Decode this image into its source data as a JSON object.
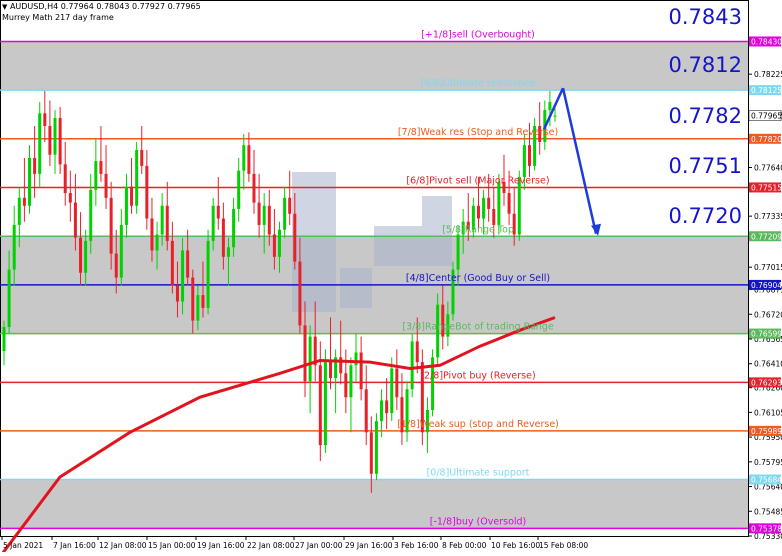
{
  "header": {
    "symbol_line": "AUDUSD,H4  0.77964 0.78043 0.77927 0.77965",
    "indicator_name": "Murrey Math 217 day frame"
  },
  "chart_data": {
    "type": "candlestick",
    "symbol": "AUDUSD",
    "timeframe": "H4",
    "ohlc_last": {
      "open": 0.77964,
      "high": 0.78043,
      "low": 0.77927,
      "close": 0.77965
    },
    "ylim": [
      0.7533,
      0.7869
    ],
    "y_ticks": [
      "0.78225",
      "0.77965",
      "0.77640",
      "0.77335",
      "0.77015",
      "0.76875",
      "0.76720",
      "0.76565",
      "0.76410",
      "0.76260",
      "0.76105",
      "0.75950",
      "0.75795",
      "0.75640",
      "0.75485",
      "0.75330"
    ],
    "x_ticks": [
      "5 Jan 2021",
      "7 Jan 16:00",
      "12 Jan 08:00",
      "15 Jan 00:00",
      "19 Jan 16:00",
      "22 Jan 08:00",
      "27 Jan 00:00",
      "29 Jan 16:00",
      "3 Feb 16:00",
      "8 Feb 00:00",
      "10 Feb 16:00",
      "15 Feb 08:00"
    ],
    "murrey_levels": [
      {
        "value": 0.7843,
        "price_label": "0.78430",
        "label": "[+1/8]sell (Overbought)",
        "color": "#e000e0"
      },
      {
        "value": 0.78125,
        "price_label": "0.78125",
        "label": "[8/8]Ultimate resistance",
        "color": "#7fd8f0"
      },
      {
        "value": 0.7782,
        "price_label": "0.77820",
        "label": "[7/8]Weak res (Stop and Reverse)",
        "color": "#f05a1e"
      },
      {
        "value": 0.77515,
        "price_label": "0.77515",
        "label": "[6/8]Pivot sell (Major Reverse)",
        "color": "#e8202a"
      },
      {
        "value": 0.77209,
        "price_label": "0.77209",
        "label": "[5/8]Range Top",
        "color": "#5cb85c"
      },
      {
        "value": 0.76904,
        "price_label": "0.76904",
        "label": "[4/8]Center (Good Buy or Sell)",
        "color": "#1414c8"
      },
      {
        "value": 0.76599,
        "price_label": "0.76599",
        "label": "[3/8]RangeBot of trading Range",
        "color": "#5cb85c"
      },
      {
        "value": 0.76293,
        "price_label": "0.76293",
        "label": "[2/8]Pivot buy (Reverse)",
        "color": "#e8202a"
      },
      {
        "value": 0.75989,
        "price_label": "0.75989",
        "label": "[1/8]Weak sup (stop and Reverse)",
        "color": "#f05a1e"
      },
      {
        "value": 0.75684,
        "price_label": "0.75684",
        "label": "[0/8]Ultimate support",
        "color": "#7fd8f0"
      },
      {
        "value": 0.75378,
        "price_label": "0.75378",
        "label": "[-1/8]buy (Oversold)",
        "color": "#e000e0"
      }
    ],
    "current_price": {
      "value": 0.77965,
      "price_label": "0.77965"
    },
    "big_labels": [
      "0.7843",
      "0.7812",
      "0.7782",
      "0.7751",
      "0.7720"
    ],
    "projection_arrow": {
      "from_price": 0.78125,
      "to_price": 0.772
    },
    "shaded_zones": [
      [
        0.78125,
        0.7843
      ],
      [
        0.76599,
        0.77209
      ],
      [
        0.75378,
        0.75684
      ]
    ],
    "colors": {
      "bull": "#00d200",
      "bear": "#e8202a",
      "ma": "#e0141e",
      "arrow": "#1e3cdc",
      "zone": "#c8c8c8",
      "watermark": "#a8b4cc"
    },
    "ma_points": [
      [
        0,
        0.752
      ],
      [
        60,
        0.757
      ],
      [
        130,
        0.7598
      ],
      [
        200,
        0.762
      ],
      [
        280,
        0.7635
      ],
      [
        320,
        0.7643
      ],
      [
        370,
        0.7642
      ],
      [
        410,
        0.7638
      ],
      [
        440,
        0.764
      ],
      [
        480,
        0.7652
      ],
      [
        520,
        0.7662
      ],
      [
        555,
        0.767
      ]
    ],
    "candles": [
      {
        "o": 0.7649,
        "h": 0.7668,
        "l": 0.764,
        "c": 0.7664
      },
      {
        "o": 0.7664,
        "h": 0.7712,
        "l": 0.766,
        "c": 0.77
      },
      {
        "o": 0.77,
        "h": 0.774,
        "l": 0.769,
        "c": 0.7728
      },
      {
        "o": 0.7728,
        "h": 0.7752,
        "l": 0.7714,
        "c": 0.7745
      },
      {
        "o": 0.7745,
        "h": 0.777,
        "l": 0.773,
        "c": 0.774
      },
      {
        "o": 0.774,
        "h": 0.7778,
        "l": 0.7735,
        "c": 0.777
      },
      {
        "o": 0.777,
        "h": 0.779,
        "l": 0.7745,
        "c": 0.776
      },
      {
        "o": 0.776,
        "h": 0.7805,
        "l": 0.7752,
        "c": 0.7798
      },
      {
        "o": 0.7798,
        "h": 0.7812,
        "l": 0.778,
        "c": 0.779
      },
      {
        "o": 0.779,
        "h": 0.7806,
        "l": 0.7765,
        "c": 0.7772
      },
      {
        "o": 0.7772,
        "h": 0.78,
        "l": 0.776,
        "c": 0.7795
      },
      {
        "o": 0.7795,
        "h": 0.7802,
        "l": 0.776,
        "c": 0.7766
      },
      {
        "o": 0.7766,
        "h": 0.778,
        "l": 0.774,
        "c": 0.7748
      },
      {
        "o": 0.7748,
        "h": 0.7762,
        "l": 0.773,
        "c": 0.7742
      },
      {
        "o": 0.7742,
        "h": 0.776,
        "l": 0.7712,
        "c": 0.772
      },
      {
        "o": 0.772,
        "h": 0.7736,
        "l": 0.769,
        "c": 0.7698
      },
      {
        "o": 0.7698,
        "h": 0.7725,
        "l": 0.769,
        "c": 0.7718
      },
      {
        "o": 0.7718,
        "h": 0.776,
        "l": 0.771,
        "c": 0.775
      },
      {
        "o": 0.775,
        "h": 0.7782,
        "l": 0.774,
        "c": 0.7768
      },
      {
        "o": 0.7768,
        "h": 0.779,
        "l": 0.7755,
        "c": 0.776
      },
      {
        "o": 0.776,
        "h": 0.7778,
        "l": 0.7738,
        "c": 0.7745
      },
      {
        "o": 0.7745,
        "h": 0.7755,
        "l": 0.77,
        "c": 0.771
      },
      {
        "o": 0.771,
        "h": 0.7725,
        "l": 0.7685,
        "c": 0.7695
      },
      {
        "o": 0.7695,
        "h": 0.7738,
        "l": 0.769,
        "c": 0.7728
      },
      {
        "o": 0.7728,
        "h": 0.776,
        "l": 0.772,
        "c": 0.7752
      },
      {
        "o": 0.7752,
        "h": 0.777,
        "l": 0.7735,
        "c": 0.774
      },
      {
        "o": 0.774,
        "h": 0.778,
        "l": 0.7735,
        "c": 0.7775
      },
      {
        "o": 0.7775,
        "h": 0.779,
        "l": 0.776,
        "c": 0.7765
      },
      {
        "o": 0.7765,
        "h": 0.7775,
        "l": 0.7725,
        "c": 0.7732
      },
      {
        "o": 0.7732,
        "h": 0.7745,
        "l": 0.7705,
        "c": 0.7712
      },
      {
        "o": 0.7712,
        "h": 0.773,
        "l": 0.77,
        "c": 0.7722
      },
      {
        "o": 0.7722,
        "h": 0.7748,
        "l": 0.7715,
        "c": 0.774
      },
      {
        "o": 0.774,
        "h": 0.7755,
        "l": 0.7712,
        "c": 0.7718
      },
      {
        "o": 0.7718,
        "h": 0.773,
        "l": 0.7685,
        "c": 0.769
      },
      {
        "o": 0.769,
        "h": 0.7705,
        "l": 0.767,
        "c": 0.768
      },
      {
        "o": 0.768,
        "h": 0.772,
        "l": 0.7672,
        "c": 0.7712
      },
      {
        "o": 0.7712,
        "h": 0.7725,
        "l": 0.769,
        "c": 0.7695
      },
      {
        "o": 0.7695,
        "h": 0.77,
        "l": 0.766,
        "c": 0.7668
      },
      {
        "o": 0.7668,
        "h": 0.769,
        "l": 0.7662,
        "c": 0.7684
      },
      {
        "o": 0.7684,
        "h": 0.7705,
        "l": 0.767,
        "c": 0.7676
      },
      {
        "o": 0.7676,
        "h": 0.7725,
        "l": 0.7672,
        "c": 0.7718
      },
      {
        "o": 0.7718,
        "h": 0.7745,
        "l": 0.7712,
        "c": 0.774
      },
      {
        "o": 0.774,
        "h": 0.7758,
        "l": 0.7725,
        "c": 0.7732
      },
      {
        "o": 0.7732,
        "h": 0.7742,
        "l": 0.77,
        "c": 0.7708
      },
      {
        "o": 0.7708,
        "h": 0.772,
        "l": 0.769,
        "c": 0.7714
      },
      {
        "o": 0.7714,
        "h": 0.7745,
        "l": 0.7708,
        "c": 0.7738
      },
      {
        "o": 0.7738,
        "h": 0.777,
        "l": 0.773,
        "c": 0.7762
      },
      {
        "o": 0.7762,
        "h": 0.7785,
        "l": 0.775,
        "c": 0.7778
      },
      {
        "o": 0.7778,
        "h": 0.7786,
        "l": 0.7755,
        "c": 0.776
      },
      {
        "o": 0.776,
        "h": 0.7775,
        "l": 0.7735,
        "c": 0.7742
      },
      {
        "o": 0.7742,
        "h": 0.776,
        "l": 0.772,
        "c": 0.7728
      },
      {
        "o": 0.7728,
        "h": 0.7748,
        "l": 0.771,
        "c": 0.774
      },
      {
        "o": 0.774,
        "h": 0.775,
        "l": 0.7715,
        "c": 0.7722
      },
      {
        "o": 0.7722,
        "h": 0.7738,
        "l": 0.77,
        "c": 0.7708
      },
      {
        "o": 0.7708,
        "h": 0.773,
        "l": 0.7698,
        "c": 0.7725
      },
      {
        "o": 0.7725,
        "h": 0.7752,
        "l": 0.772,
        "c": 0.7745
      },
      {
        "o": 0.7745,
        "h": 0.7762,
        "l": 0.7728,
        "c": 0.7735
      },
      {
        "o": 0.7735,
        "h": 0.7748,
        "l": 0.77,
        "c": 0.7705
      },
      {
        "o": 0.7705,
        "h": 0.772,
        "l": 0.766,
        "c": 0.7665
      },
      {
        "o": 0.7665,
        "h": 0.768,
        "l": 0.762,
        "c": 0.763
      },
      {
        "o": 0.763,
        "h": 0.7665,
        "l": 0.761,
        "c": 0.7658
      },
      {
        "o": 0.7658,
        "h": 0.768,
        "l": 0.763,
        "c": 0.764
      },
      {
        "o": 0.764,
        "h": 0.7655,
        "l": 0.758,
        "c": 0.759
      },
      {
        "o": 0.759,
        "h": 0.765,
        "l": 0.7585,
        "c": 0.7642
      },
      {
        "o": 0.7642,
        "h": 0.767,
        "l": 0.7625,
        "c": 0.7632
      },
      {
        "o": 0.7632,
        "h": 0.765,
        "l": 0.761,
        "c": 0.7645
      },
      {
        "o": 0.7645,
        "h": 0.7668,
        "l": 0.7628,
        "c": 0.7635
      },
      {
        "o": 0.7635,
        "h": 0.765,
        "l": 0.761,
        "c": 0.762
      },
      {
        "o": 0.762,
        "h": 0.7645,
        "l": 0.7598,
        "c": 0.764
      },
      {
        "o": 0.764,
        "h": 0.766,
        "l": 0.763,
        "c": 0.7648
      },
      {
        "o": 0.7648,
        "h": 0.7658,
        "l": 0.7618,
        "c": 0.7625
      },
      {
        "o": 0.7625,
        "h": 0.764,
        "l": 0.759,
        "c": 0.7598
      },
      {
        "o": 0.7598,
        "h": 0.7608,
        "l": 0.756,
        "c": 0.7572
      },
      {
        "o": 0.7572,
        "h": 0.761,
        "l": 0.7568,
        "c": 0.7605
      },
      {
        "o": 0.7605,
        "h": 0.7625,
        "l": 0.7595,
        "c": 0.7618
      },
      {
        "o": 0.7618,
        "h": 0.7632,
        "l": 0.76,
        "c": 0.761
      },
      {
        "o": 0.761,
        "h": 0.7645,
        "l": 0.7605,
        "c": 0.7638
      },
      {
        "o": 0.7638,
        "h": 0.765,
        "l": 0.7612,
        "c": 0.762
      },
      {
        "o": 0.762,
        "h": 0.7635,
        "l": 0.759,
        "c": 0.7598
      },
      {
        "o": 0.7598,
        "h": 0.763,
        "l": 0.7592,
        "c": 0.7625
      },
      {
        "o": 0.7625,
        "h": 0.766,
        "l": 0.762,
        "c": 0.7655
      },
      {
        "o": 0.7655,
        "h": 0.767,
        "l": 0.7635,
        "c": 0.7642
      },
      {
        "o": 0.7642,
        "h": 0.765,
        "l": 0.759,
        "c": 0.7598
      },
      {
        "o": 0.7598,
        "h": 0.762,
        "l": 0.7585,
        "c": 0.7612
      },
      {
        "o": 0.7612,
        "h": 0.765,
        "l": 0.7608,
        "c": 0.7645
      },
      {
        "o": 0.7645,
        "h": 0.7685,
        "l": 0.764,
        "c": 0.7678
      },
      {
        "o": 0.7678,
        "h": 0.769,
        "l": 0.765,
        "c": 0.7658
      },
      {
        "o": 0.7658,
        "h": 0.768,
        "l": 0.7652,
        "c": 0.7672
      },
      {
        "o": 0.7672,
        "h": 0.7705,
        "l": 0.7668,
        "c": 0.77
      },
      {
        "o": 0.77,
        "h": 0.7728,
        "l": 0.769,
        "c": 0.7722
      },
      {
        "o": 0.7722,
        "h": 0.7738,
        "l": 0.771,
        "c": 0.773
      },
      {
        "o": 0.773,
        "h": 0.7748,
        "l": 0.7718,
        "c": 0.7725
      },
      {
        "o": 0.7725,
        "h": 0.7745,
        "l": 0.772,
        "c": 0.774
      },
      {
        "o": 0.774,
        "h": 0.7758,
        "l": 0.7725,
        "c": 0.7732
      },
      {
        "o": 0.7732,
        "h": 0.775,
        "l": 0.7722,
        "c": 0.7745
      },
      {
        "o": 0.7745,
        "h": 0.776,
        "l": 0.773,
        "c": 0.7738
      },
      {
        "o": 0.7738,
        "h": 0.7752,
        "l": 0.772,
        "c": 0.7728
      },
      {
        "o": 0.7728,
        "h": 0.776,
        "l": 0.7722,
        "c": 0.7755
      },
      {
        "o": 0.7755,
        "h": 0.7772,
        "l": 0.774,
        "c": 0.7748
      },
      {
        "o": 0.7748,
        "h": 0.7762,
        "l": 0.7728,
        "c": 0.7735
      },
      {
        "o": 0.7735,
        "h": 0.7752,
        "l": 0.7715,
        "c": 0.7722
      },
      {
        "o": 0.7722,
        "h": 0.7762,
        "l": 0.7718,
        "c": 0.7758
      },
      {
        "o": 0.7758,
        "h": 0.7785,
        "l": 0.775,
        "c": 0.7778
      },
      {
        "o": 0.7778,
        "h": 0.7792,
        "l": 0.7758,
        "c": 0.7765
      },
      {
        "o": 0.7765,
        "h": 0.7795,
        "l": 0.7762,
        "c": 0.779
      },
      {
        "o": 0.779,
        "h": 0.7805,
        "l": 0.7772,
        "c": 0.778
      },
      {
        "o": 0.778,
        "h": 0.7806,
        "l": 0.7775,
        "c": 0.78
      },
      {
        "o": 0.78,
        "h": 0.7812,
        "l": 0.779,
        "c": 0.7805
      },
      {
        "o": 0.77964,
        "h": 0.78043,
        "l": 0.77927,
        "c": 0.77965
      }
    ]
  }
}
